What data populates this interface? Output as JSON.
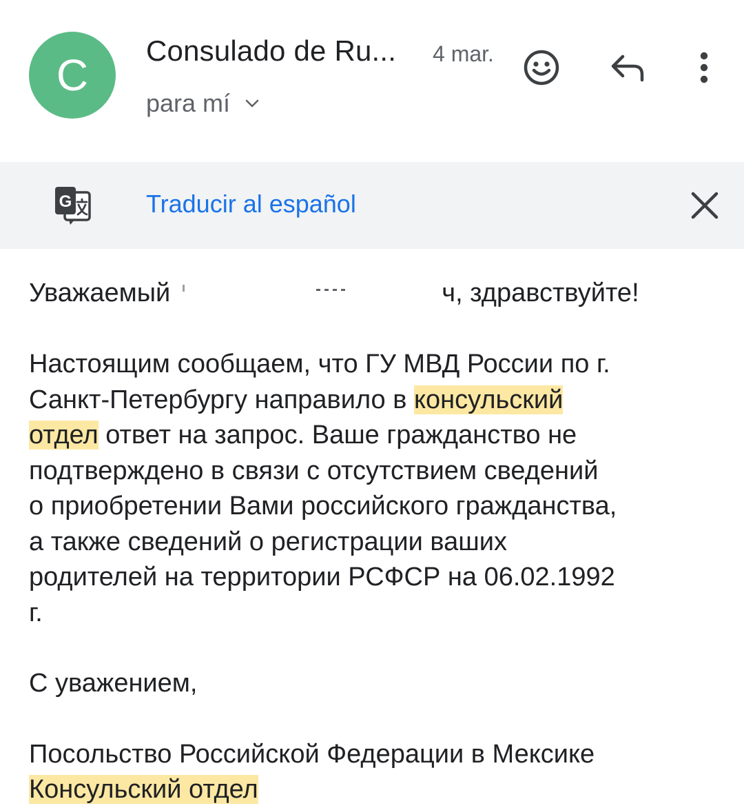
{
  "email": {
    "avatar_letter": "C",
    "avatar_color": "#5bbb86",
    "sender": "Consulado de Ru...",
    "date": "4 mar.",
    "recipient": "para mí",
    "actions": {
      "emoji_icon": "add-reaction-icon",
      "reply_icon": "reply-icon",
      "more_icon": "more-vert-icon"
    }
  },
  "translate_bar": {
    "icon": "google-translate-icon",
    "link_label": "Traducir al español",
    "close_icon": "close-icon",
    "background": "#f1f3f4",
    "link_color": "#1a73e8"
  },
  "body": {
    "greeting_start": "Уважаемый",
    "greeting_end": "ч, здравствуйте!",
    "p1_line1": "Настоящим сообщаем, что ГУ МВД России по г.",
    "p1_line2_pre": "Санкт-Петербургу направило в ",
    "p1_line2_hl": "консульский",
    "p1_line3_hl": "отдел",
    "p1_line3_post": " ответ на запрос. Ваше гражданство не",
    "p1_line4": "подтверждено в связи с отсутствием сведений",
    "p1_line5": "о приобретении Вами российского гражданства,",
    "p1_line6": "а также сведений о регистрации ваших",
    "p1_line7": "родителей на территории РСФСР на 06.02.1992",
    "p1_line8": "г.",
    "closing": "С уважением,",
    "signature_line1": "Посольство Российской Федерации в Мексике",
    "signature_line2_hl": "Консульский отдел",
    "highlight_color": "#fce8a3"
  }
}
